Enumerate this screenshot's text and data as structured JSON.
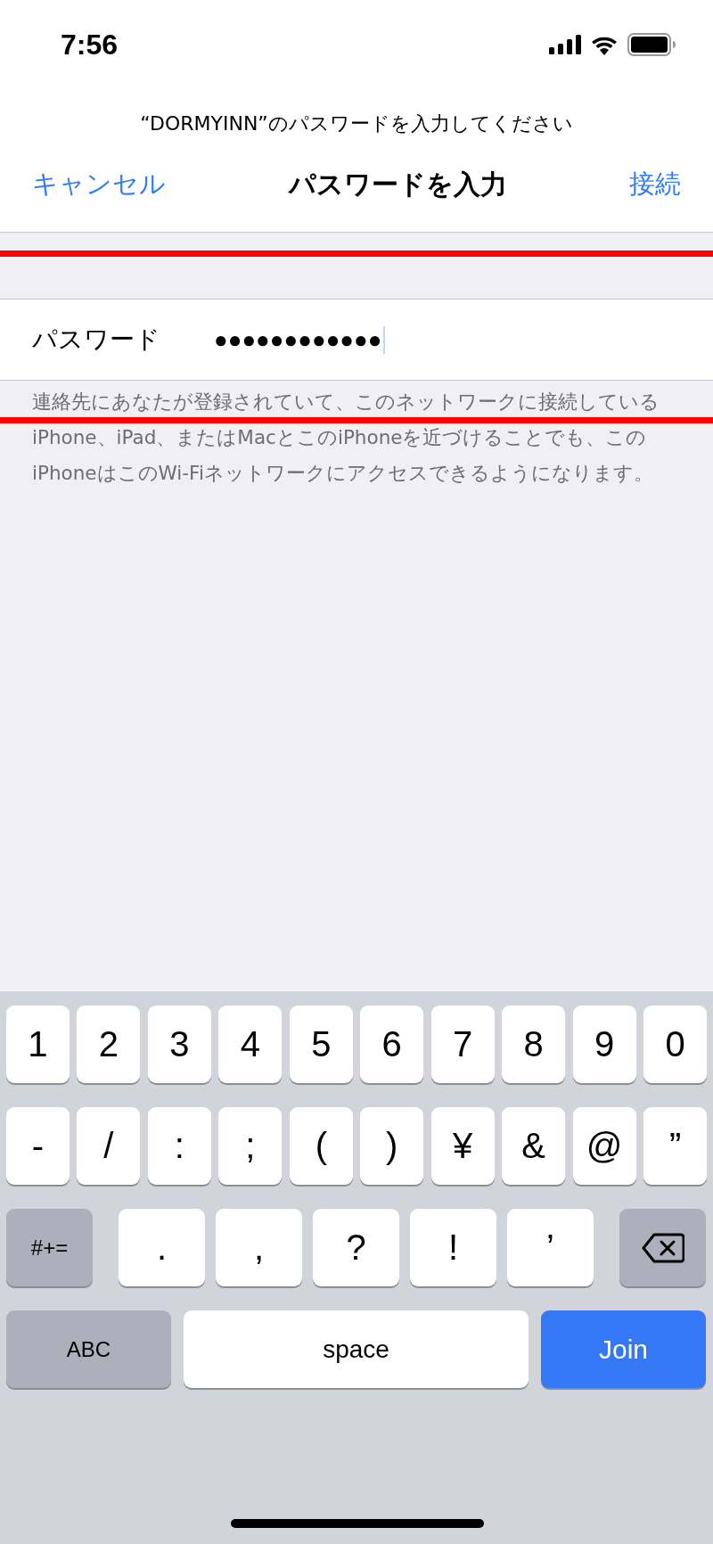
{
  "status_bar": {
    "time": "7:56"
  },
  "prompt": "“DORMYINN”のパスワードを入力してください",
  "nav": {
    "cancel": "キャンセル",
    "title": "パスワードを入力",
    "connect": "接続"
  },
  "password": {
    "label": "パスワード",
    "value": "●●●●●●●●●●●●"
  },
  "footer": "連絡先にあなたが登録されていて、このネットワークに接続しているiPhone、iPad、またはMacとこのiPhoneを近づけることでも、このiPhoneはこのWi-Fiネットワークにアクセスできるようになります。",
  "overlay_lines": [
    {
      "kind": "rule",
      "color": "#ff0000"
    },
    {
      "kind": "rule",
      "color": "#ff0000"
    }
  ],
  "keyboard": {
    "rows": [
      {
        "keys": [
          {
            "label": "1",
            "kind": "char"
          },
          {
            "label": "2",
            "kind": "char"
          },
          {
            "label": "3",
            "kind": "char"
          },
          {
            "label": "4",
            "kind": "char"
          },
          {
            "label": "5",
            "kind": "char"
          },
          {
            "label": "6",
            "kind": "char"
          },
          {
            "label": "7",
            "kind": "char"
          },
          {
            "label": "8",
            "kind": "char"
          },
          {
            "label": "9",
            "kind": "char"
          },
          {
            "label": "0",
            "kind": "char"
          }
        ]
      },
      {
        "keys": [
          {
            "label": "-",
            "kind": "char"
          },
          {
            "label": "/",
            "kind": "char"
          },
          {
            "label": ":",
            "kind": "char"
          },
          {
            "label": ";",
            "kind": "char"
          },
          {
            "label": "(",
            "kind": "char"
          },
          {
            "label": ")",
            "kind": "char"
          },
          {
            "label": "¥",
            "kind": "char"
          },
          {
            "label": "&",
            "kind": "char"
          },
          {
            "label": "@",
            "kind": "char"
          },
          {
            "label": "”",
            "kind": "char"
          }
        ]
      },
      {
        "keys": [
          {
            "label": "#+=",
            "kind": "function"
          },
          {
            "label": ".",
            "kind": "wide"
          },
          {
            "label": ",",
            "kind": "wide"
          },
          {
            "label": "?",
            "kind": "wide"
          },
          {
            "label": "!",
            "kind": "wide"
          },
          {
            "label": "’",
            "kind": "wide"
          },
          {
            "kind": "delete"
          }
        ]
      },
      {
        "keys": [
          {
            "label": "ABC",
            "kind": "function"
          },
          {
            "label": "space",
            "kind": "space"
          },
          {
            "label": "Join",
            "kind": "primary"
          }
        ]
      }
    ]
  }
}
